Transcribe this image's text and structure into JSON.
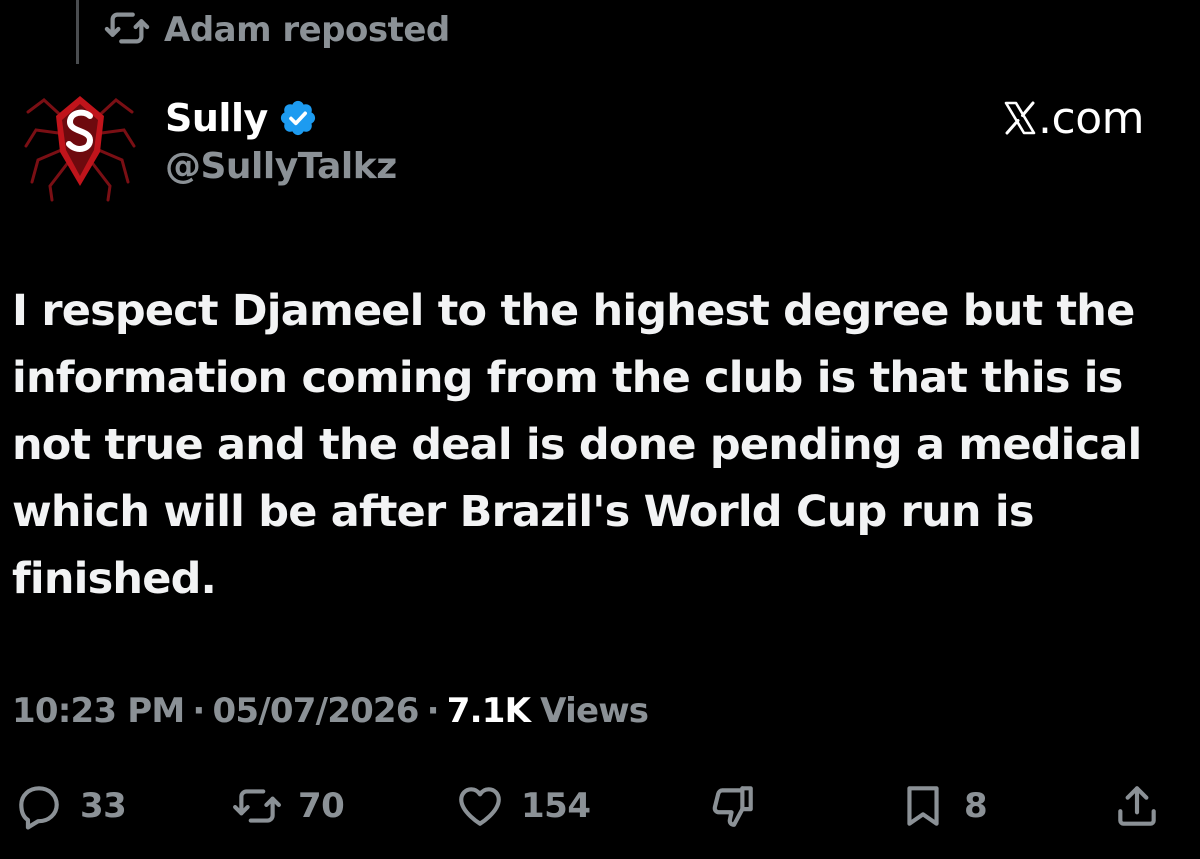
{
  "repost_banner": {
    "icon": "repost-icon",
    "text": "Adam reposted"
  },
  "author": {
    "avatar_icon": "spider-logo-avatar",
    "name": "Sully",
    "verified": true,
    "verified_color": "#1d9bf0",
    "handle": "@SullyTalkz"
  },
  "brand": {
    "icon": "x-logo-icon",
    "text": ".com"
  },
  "tweet": {
    "text": "I respect Djameel to the highest degree but the information coming from the club is that this is not true and the deal is done pending a medical which will be after Brazil's World Cup run is finished."
  },
  "meta": {
    "time": "10:23 PM",
    "separator": "·",
    "date": "05/07/2026",
    "views_count": "7.1K",
    "views_label": "Views"
  },
  "actions": {
    "reply": {
      "icon": "reply-icon",
      "count": "33"
    },
    "repost": {
      "icon": "repost-icon",
      "count": "70"
    },
    "like": {
      "icon": "heart-icon",
      "count": "154"
    },
    "dislike": {
      "icon": "thumbs-down-icon"
    },
    "bookmark": {
      "icon": "bookmark-icon",
      "count": "8"
    },
    "share": {
      "icon": "share-icon"
    }
  },
  "colors": {
    "background": "#000000",
    "primary_text": "#e7e9ea",
    "secondary_text": "#8b9196",
    "avatar_red": "#c0141b"
  }
}
